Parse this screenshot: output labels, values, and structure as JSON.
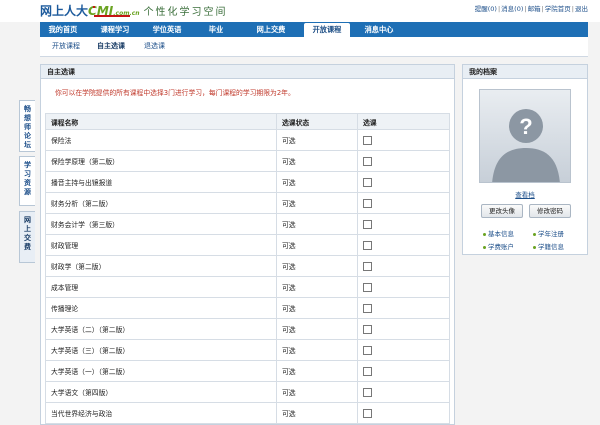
{
  "header": {
    "logo_text": "网上人大",
    "logo_cmi": "CMI",
    "logo_domain": ".com.cn",
    "slogan": "个性化学习空间",
    "top_links": [
      {
        "label": "提醒(0)"
      },
      {
        "label": "消息(0)"
      },
      {
        "label": "邮箱"
      },
      {
        "label": "学院首页"
      },
      {
        "label": "退出"
      }
    ]
  },
  "nav": {
    "items": [
      {
        "label": "我的首页"
      },
      {
        "label": "课程学习"
      },
      {
        "label": "学位英语"
      },
      {
        "label": "毕业"
      },
      {
        "label": "网上交费"
      },
      {
        "label": "开放课程"
      },
      {
        "label": "消息中心"
      }
    ],
    "active_index": 5
  },
  "subnav": {
    "items": [
      {
        "label": "开放课程"
      },
      {
        "label": "自主选课"
      },
      {
        "label": "退选课"
      }
    ],
    "active_index": 1
  },
  "side_tabs": [
    {
      "label": "畅\n想\n师\n论\n坛"
    },
    {
      "label": "学\n习\n资\n源"
    },
    {
      "label": "网\n上\n交\n费"
    }
  ],
  "main": {
    "title": "自主选课",
    "notice": "你可以在学院提供的所有课程中选择3门进行学习，每门课程的学习期限为2年。",
    "columns": [
      "课程名称",
      "选课状态",
      "选课"
    ],
    "rows": [
      {
        "name": "保险法",
        "status": "可选"
      },
      {
        "name": "保险学原理（第二版）",
        "status": "可选"
      },
      {
        "name": "播音主持与出镜报道",
        "status": "可选"
      },
      {
        "name": "财务分析（第二版）",
        "status": "可选"
      },
      {
        "name": "财务会计学（第三版）",
        "status": "可选"
      },
      {
        "name": "财政管理",
        "status": "可选"
      },
      {
        "name": "财政学（第二版）",
        "status": "可选"
      },
      {
        "name": "成本管理",
        "status": "可选"
      },
      {
        "name": "传播理论",
        "status": "可选"
      },
      {
        "name": "大学英语（二）（第二版）",
        "status": "可选"
      },
      {
        "name": "大学英语（三）（第二版）",
        "status": "可选"
      },
      {
        "name": "大学英语（一）（第二版）",
        "status": "可选"
      },
      {
        "name": "大学语文（第四版）",
        "status": "可选"
      },
      {
        "name": "当代世界经济与政治",
        "status": "可选"
      }
    ]
  },
  "profile": {
    "title": "我的档案",
    "view_label": "查看档",
    "change_avatar": "更改头像",
    "change_password": "修改密码",
    "links": [
      {
        "label": "基本信息"
      },
      {
        "label": "学年注册"
      },
      {
        "label": "学费账户"
      },
      {
        "label": "学籍信息"
      }
    ]
  },
  "colors": {
    "nav_blue": "#1e6fb5",
    "link_blue": "#1d4f8a",
    "notice_red": "#c0392b",
    "accent_green": "#6aa321"
  }
}
